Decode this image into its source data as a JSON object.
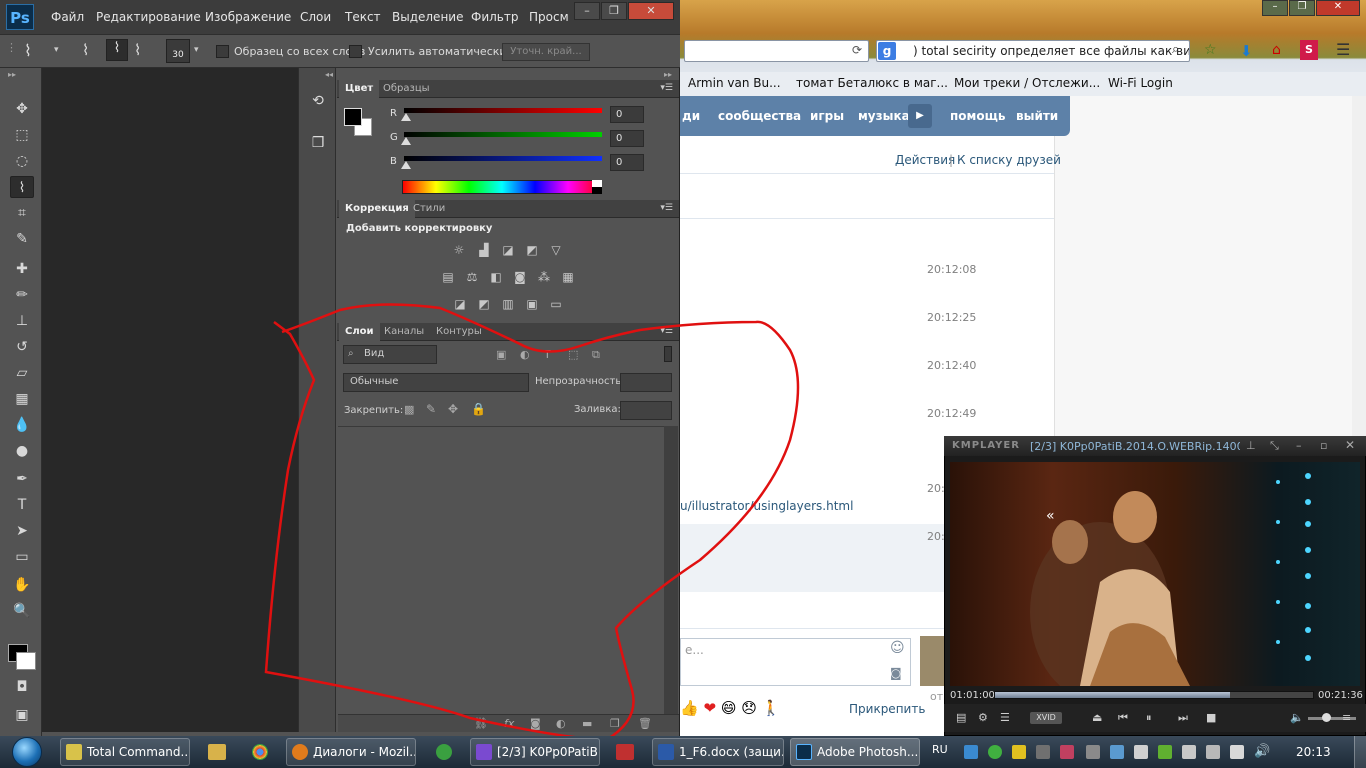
{
  "photoshop": {
    "logo": "Ps",
    "menu": [
      "Файл",
      "Редактирование",
      "Изображение",
      "Слои",
      "Текст",
      "Выделение",
      "Фильтр",
      "Просм"
    ],
    "options": {
      "brush_size": "30",
      "sample_all_layers": "Образец со всех слоев",
      "auto_enhance": "Усилить автоматически",
      "refine_edge": "Уточн. край..."
    },
    "color_panel": {
      "tabs": [
        "Цвет",
        "Образцы"
      ],
      "channels": [
        {
          "label": "R",
          "value": "0",
          "color": "#ff0000"
        },
        {
          "label": "G",
          "value": "0",
          "color": "#00d000"
        },
        {
          "label": "B",
          "value": "0",
          "color": "#1030ff"
        }
      ]
    },
    "adjustments_panel": {
      "tabs": [
        "Коррекция",
        "Стили"
      ],
      "title": "Добавить корректировку"
    },
    "layers_panel": {
      "tabs": [
        "Слои",
        "Каналы",
        "Контуры"
      ],
      "filter_placeholder": "Вид",
      "blend_mode": "Обычные",
      "opacity_label": "Непрозрачность:",
      "lock_label": "Закрепить:",
      "fill_label": "Заливка:",
      "footer_icons": [
        "link-icon",
        "fx-icon",
        "mask-icon",
        "adjustment-icon",
        "folder-icon",
        "new-layer-icon",
        "trash-icon"
      ]
    }
  },
  "firefox": {
    "search_text": ") total secirity определяет все файлы как вирус",
    "bookmarks": [
      "Armin van Bu...",
      "томат Беталюкс в маг...",
      "Мои треки / Отслежи...",
      "Wi-Fi Login"
    ],
    "vk_nav": [
      "ди",
      "сообщества",
      "игры",
      "музыка",
      "помощь",
      "выйти"
    ],
    "vk_links": {
      "actions": "Действия",
      "separator": "|",
      "friends": "К списку друзей"
    },
    "timestamps": [
      "20:12:08",
      "20:12:25",
      "20:12:40",
      "20:12:49",
      "20:",
      "20:"
    ],
    "message_link": "u/illustrator/usinglayers.html",
    "input_placeholder": "е...",
    "attach_label": "Прикрепить",
    "extra_text": "от"
  },
  "kmplayer": {
    "logo": "KMPLAYER",
    "caption": "[2/3] K0Pp0PatiB.2014.O.WEBRip.1400MB.",
    "time_current": "01:01:00",
    "time_total": "00:21:36",
    "progress": 0.74,
    "codec_badge": "XVID"
  },
  "taskbar": {
    "items": [
      {
        "label": "Total Command...",
        "color": "#d8c24a"
      },
      {
        "label": "Диалоги - Mozil...",
        "color": "#e07b1c"
      },
      {
        "label": "[2/3] K0Pp0PatiB...",
        "color": "#7a4ad0"
      },
      {
        "label": "1_F6.docx (защи...",
        "color": "#2b5aa8"
      },
      {
        "label": "Adobe Photosh...",
        "color": "#0b2d4a"
      }
    ],
    "language": "RU",
    "clock": "20:13"
  }
}
